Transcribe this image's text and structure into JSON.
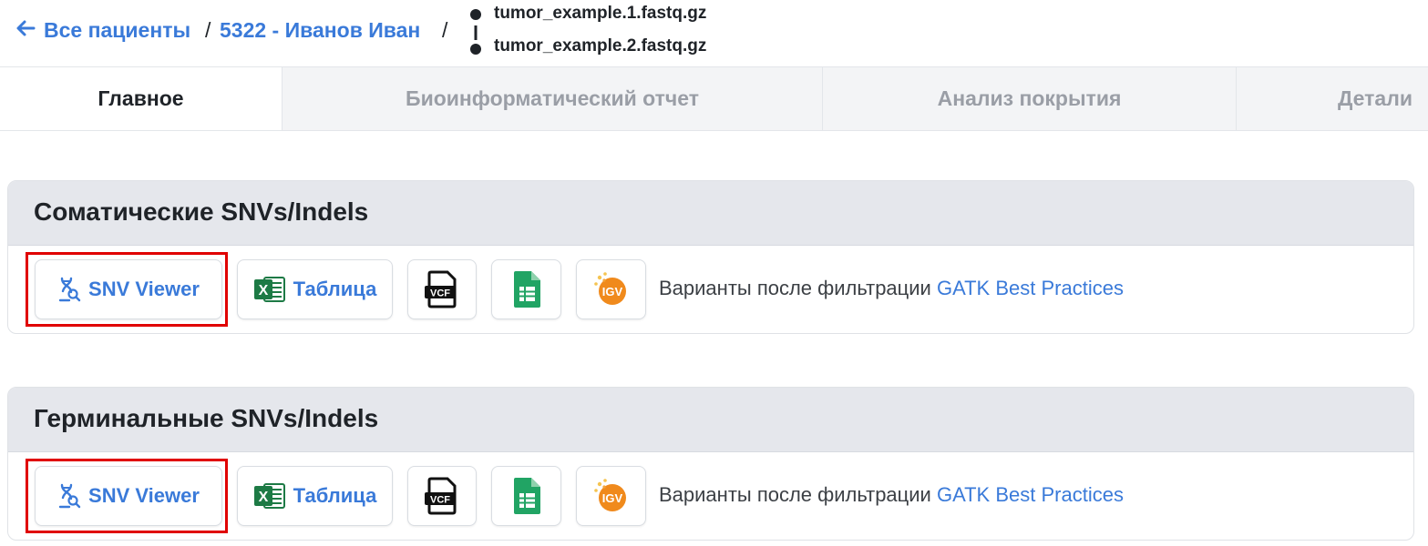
{
  "breadcrumb": {
    "all_patients": "Все пациенты",
    "patient": "5322 - Иванов Иван",
    "separator": "/"
  },
  "files": [
    "tumor_example.1.fastq.gz",
    "tumor_example.2.fastq.gz"
  ],
  "tabs": [
    {
      "label": "Главное",
      "active": true
    },
    {
      "label": "Биоинформатический отчет",
      "active": false
    },
    {
      "label": "Анализ покрытия",
      "active": false
    },
    {
      "label": "Детали",
      "active": false
    }
  ],
  "sections": [
    {
      "title": "Соматические SNVs/Indels",
      "snv_viewer_label": "SNV Viewer",
      "table_label": "Таблица",
      "description": "Варианты после фильтрации ",
      "description_link": "GATK Best Practices"
    },
    {
      "title": "Герминальные SNVs/Indels",
      "snv_viewer_label": "SNV Viewer",
      "table_label": "Таблица",
      "description": "Варианты после фильтрации ",
      "description_link": "GATK Best Practices"
    }
  ],
  "icons": {
    "vcf_text": "VCF",
    "igv_text": "IGV",
    "excel_letter": "X"
  },
  "colors": {
    "link": "#3a7ad9",
    "excel_green": "#1d7a45",
    "sheets_green": "#21a464",
    "highlight_red": "#e00000",
    "igv_orange": "#f08a1c"
  }
}
